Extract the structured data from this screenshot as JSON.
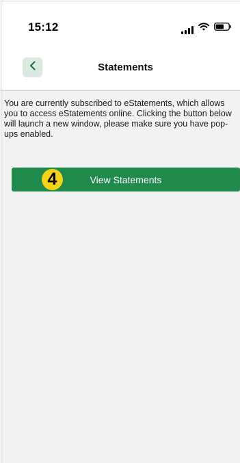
{
  "status_bar": {
    "time": "15:12",
    "icons": [
      "cellular-signal-icon",
      "wifi-icon",
      "battery-icon"
    ]
  },
  "nav": {
    "back_icon": "chevron-left-icon",
    "title": "Statements"
  },
  "content": {
    "description": "You are currently subscribed to eStatements, which allows you to access eStatements online. Clicking the button below will launch a new window, please make sure you have pop-ups enabled.",
    "button_label": "View Statements",
    "step_number": "4"
  },
  "colors": {
    "accent_green": "#1f8a4c",
    "back_button_bg": "#dbe9e3",
    "badge_yellow": "#f7d316",
    "background": "#f2f2f2"
  }
}
